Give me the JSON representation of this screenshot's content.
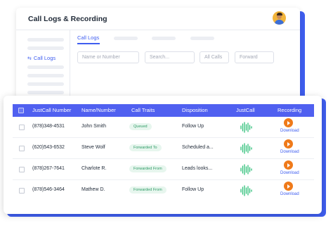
{
  "app": {
    "title": "Call Logs & Recording"
  },
  "sidebar": {
    "active_item": "Call Logs",
    "active_icon": "sliders-icon"
  },
  "tabs": {
    "active": "Call Logs"
  },
  "filters": {
    "name_placeholder": "Name or Number",
    "search_placeholder": "Search...",
    "calls_select": "All Calls",
    "forward_select": "Forward"
  },
  "table": {
    "headers": [
      "JustCall Number",
      "Name/Number",
      "Call Traits",
      "Disposition",
      "JustCall",
      "Recording"
    ],
    "rows": [
      {
        "number": "(878)348-4531",
        "name": "John Smith",
        "trait": "Queued",
        "disposition": "Follow Up",
        "recording": "Download"
      },
      {
        "number": "(620)543-6532",
        "name": "Steve Wolf",
        "trait": "Forwarded To",
        "disposition": "Scheduled a...",
        "recording": "Download"
      },
      {
        "number": "(878)267-7641",
        "name": "Charlote R.",
        "trait": "Forwarded From",
        "disposition": "Leads looks...",
        "recording": "Download"
      },
      {
        "number": "(878)546-3464",
        "name": "Mathew D.",
        "trait": "Forwarded From",
        "disposition": "Follow Up",
        "recording": "Download"
      }
    ]
  },
  "colors": {
    "accent": "#3f5ef0",
    "header_bg": "#5060f0",
    "badge_bg": "#e7f6ee",
    "badge_text": "#2f9b66",
    "waveform": "#2fbf7a",
    "play_button": "#ef7a1a"
  }
}
